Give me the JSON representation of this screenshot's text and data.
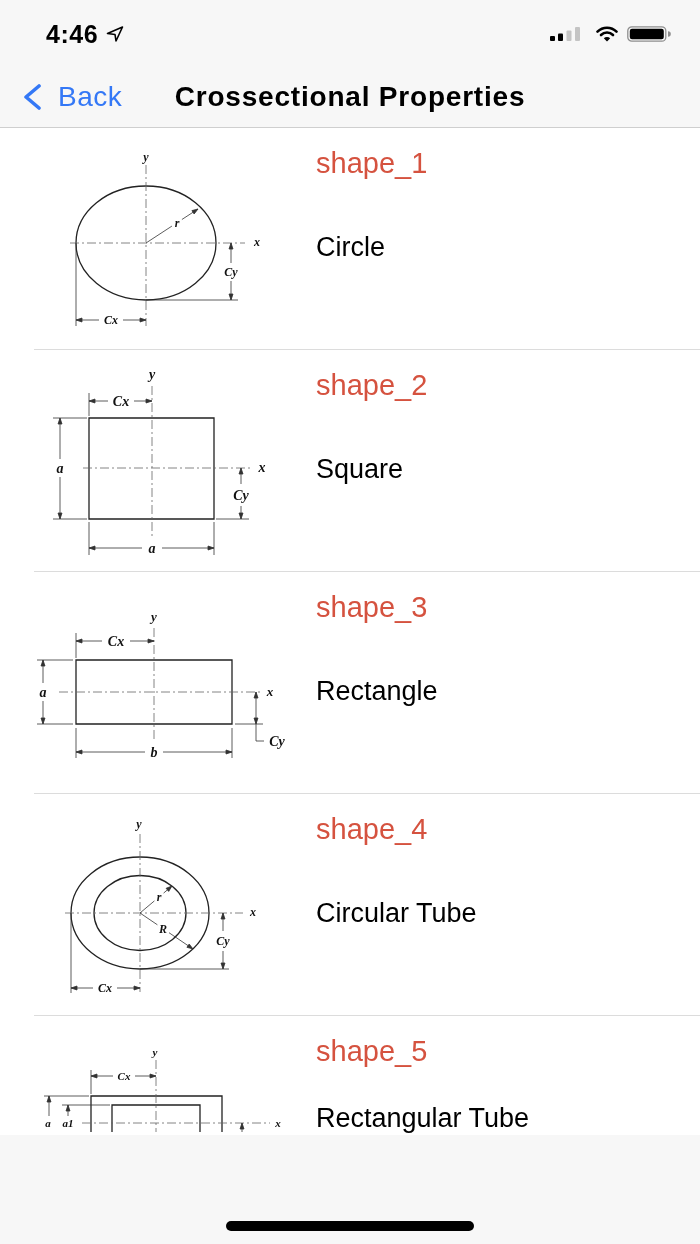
{
  "status_bar": {
    "time": "4:46"
  },
  "nav_bar": {
    "back_label": "Back",
    "title": "Crossectional Properties"
  },
  "shapes": [
    {
      "code": "shape_1",
      "name": "Circle",
      "diagram": {
        "kind": "circle",
        "labels": [
          "y",
          "r",
          "x",
          "Cy",
          "Cx"
        ]
      }
    },
    {
      "code": "shape_2",
      "name": "Square",
      "diagram": {
        "kind": "square",
        "labels": [
          "y",
          "Cx",
          "a",
          "x",
          "Cy",
          "a"
        ]
      }
    },
    {
      "code": "shape_3",
      "name": "Rectangle",
      "diagram": {
        "kind": "rectangle",
        "labels": [
          "y",
          "Cx",
          "a",
          "x",
          "Cy",
          "b"
        ]
      }
    },
    {
      "code": "shape_4",
      "name": "Circular Tube",
      "diagram": {
        "kind": "circular_tube",
        "labels": [
          "y",
          "r",
          "x",
          "R",
          "Cy",
          "Cx"
        ]
      }
    },
    {
      "code": "shape_5",
      "name": "Rectangular Tube",
      "diagram": {
        "kind": "rectangular_tube",
        "labels": [
          "y",
          "Cx",
          "a",
          "a1",
          "x"
        ]
      }
    }
  ]
}
